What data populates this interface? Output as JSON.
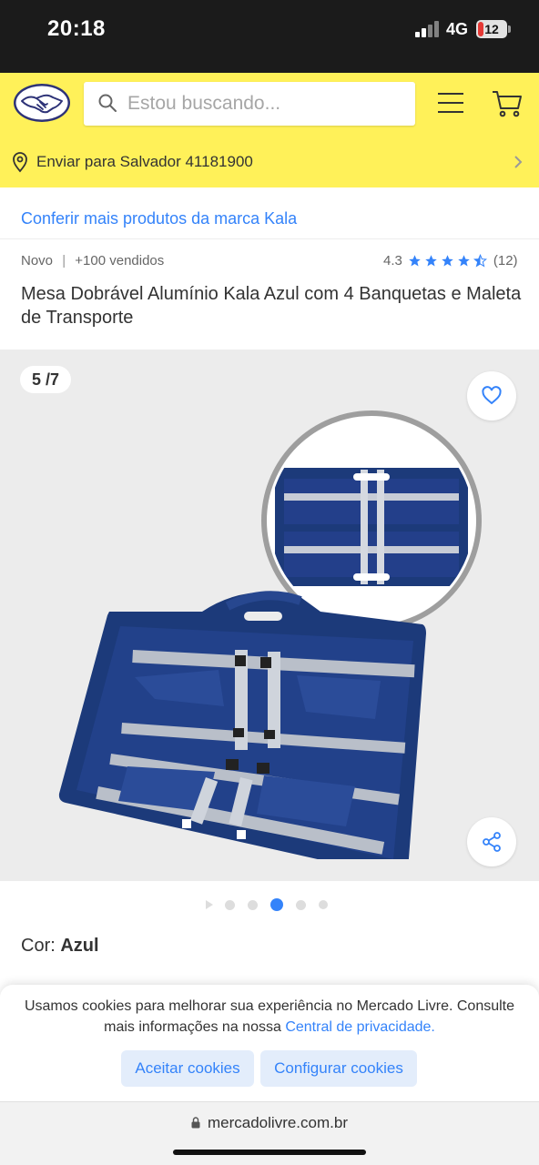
{
  "status_bar": {
    "time": "20:18",
    "network": "4G",
    "battery": "12"
  },
  "header": {
    "search_placeholder": "Estou buscando...",
    "delivery_text": "Enviar para Salvador 41181900"
  },
  "product": {
    "brand_link": "Conferir mais produtos da marca Kala",
    "condition": "Novo",
    "sold": "+100 vendidos",
    "rating_value": "4.3",
    "rating_stars": 4.3,
    "rating_count": "(12)",
    "title": "Mesa Dobrável Alumínio Kala Azul com 4 Banquetas e Maleta de Transporte"
  },
  "gallery": {
    "counter": "5 /7",
    "active_dot": 2
  },
  "color": {
    "label": "Cor:",
    "value": "Azul"
  },
  "cookie": {
    "text": "Usamos cookies para melhorar sua experiência no Mercado Livre. Consulte mais informações na nossa",
    "link": "Central de privacidade.",
    "accept_label": "Aceitar cookies",
    "config_label": "Configurar cookies"
  },
  "browser": {
    "url": "mercadolivre.com.br"
  },
  "colors": {
    "brand_yellow": "#fff159",
    "accent_blue": "#3483fa",
    "product_blue": "#1c3a7a"
  }
}
